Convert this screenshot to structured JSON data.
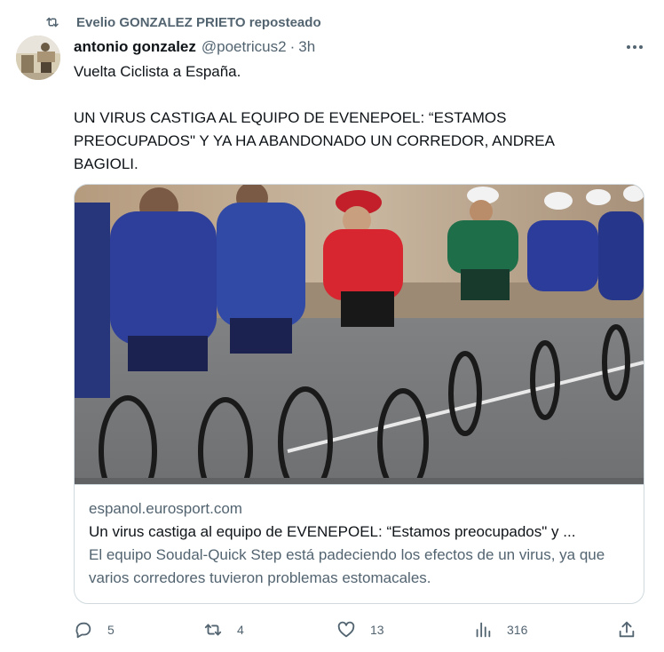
{
  "repost": {
    "icon": "repost-icon",
    "text": "Evelio GONZALEZ PRIETO reposteado"
  },
  "author": {
    "name": "antonio gonzalez",
    "handle": "@poetricus2",
    "separator": "·",
    "time": "3h"
  },
  "tweet": {
    "lines": [
      "Vuelta Ciclista a España.",
      "",
      "UN VIRUS CASTIGA AL EQUIPO DE EVENEPOEL: “ESTAMOS PREOCUPADOS\" Y YA HA ABANDONADO UN CORREDOR, ANDREA BAGIOLI."
    ]
  },
  "card": {
    "domain": "espanol.eurosport.com",
    "title": "Un virus castiga al equipo de EVENEPOEL: “Estamos preocupados\" y ...",
    "description": "El equipo Soudal-Quick Step está padeciendo los efectos de un virus, ya que varios corredores tuvieron problemas estomacales."
  },
  "actions": {
    "replies": "5",
    "reposts": "4",
    "likes": "13",
    "views": "316"
  },
  "colors": {
    "text": "#0f1419",
    "secondary": "#536471",
    "border": "#cfd9de"
  }
}
